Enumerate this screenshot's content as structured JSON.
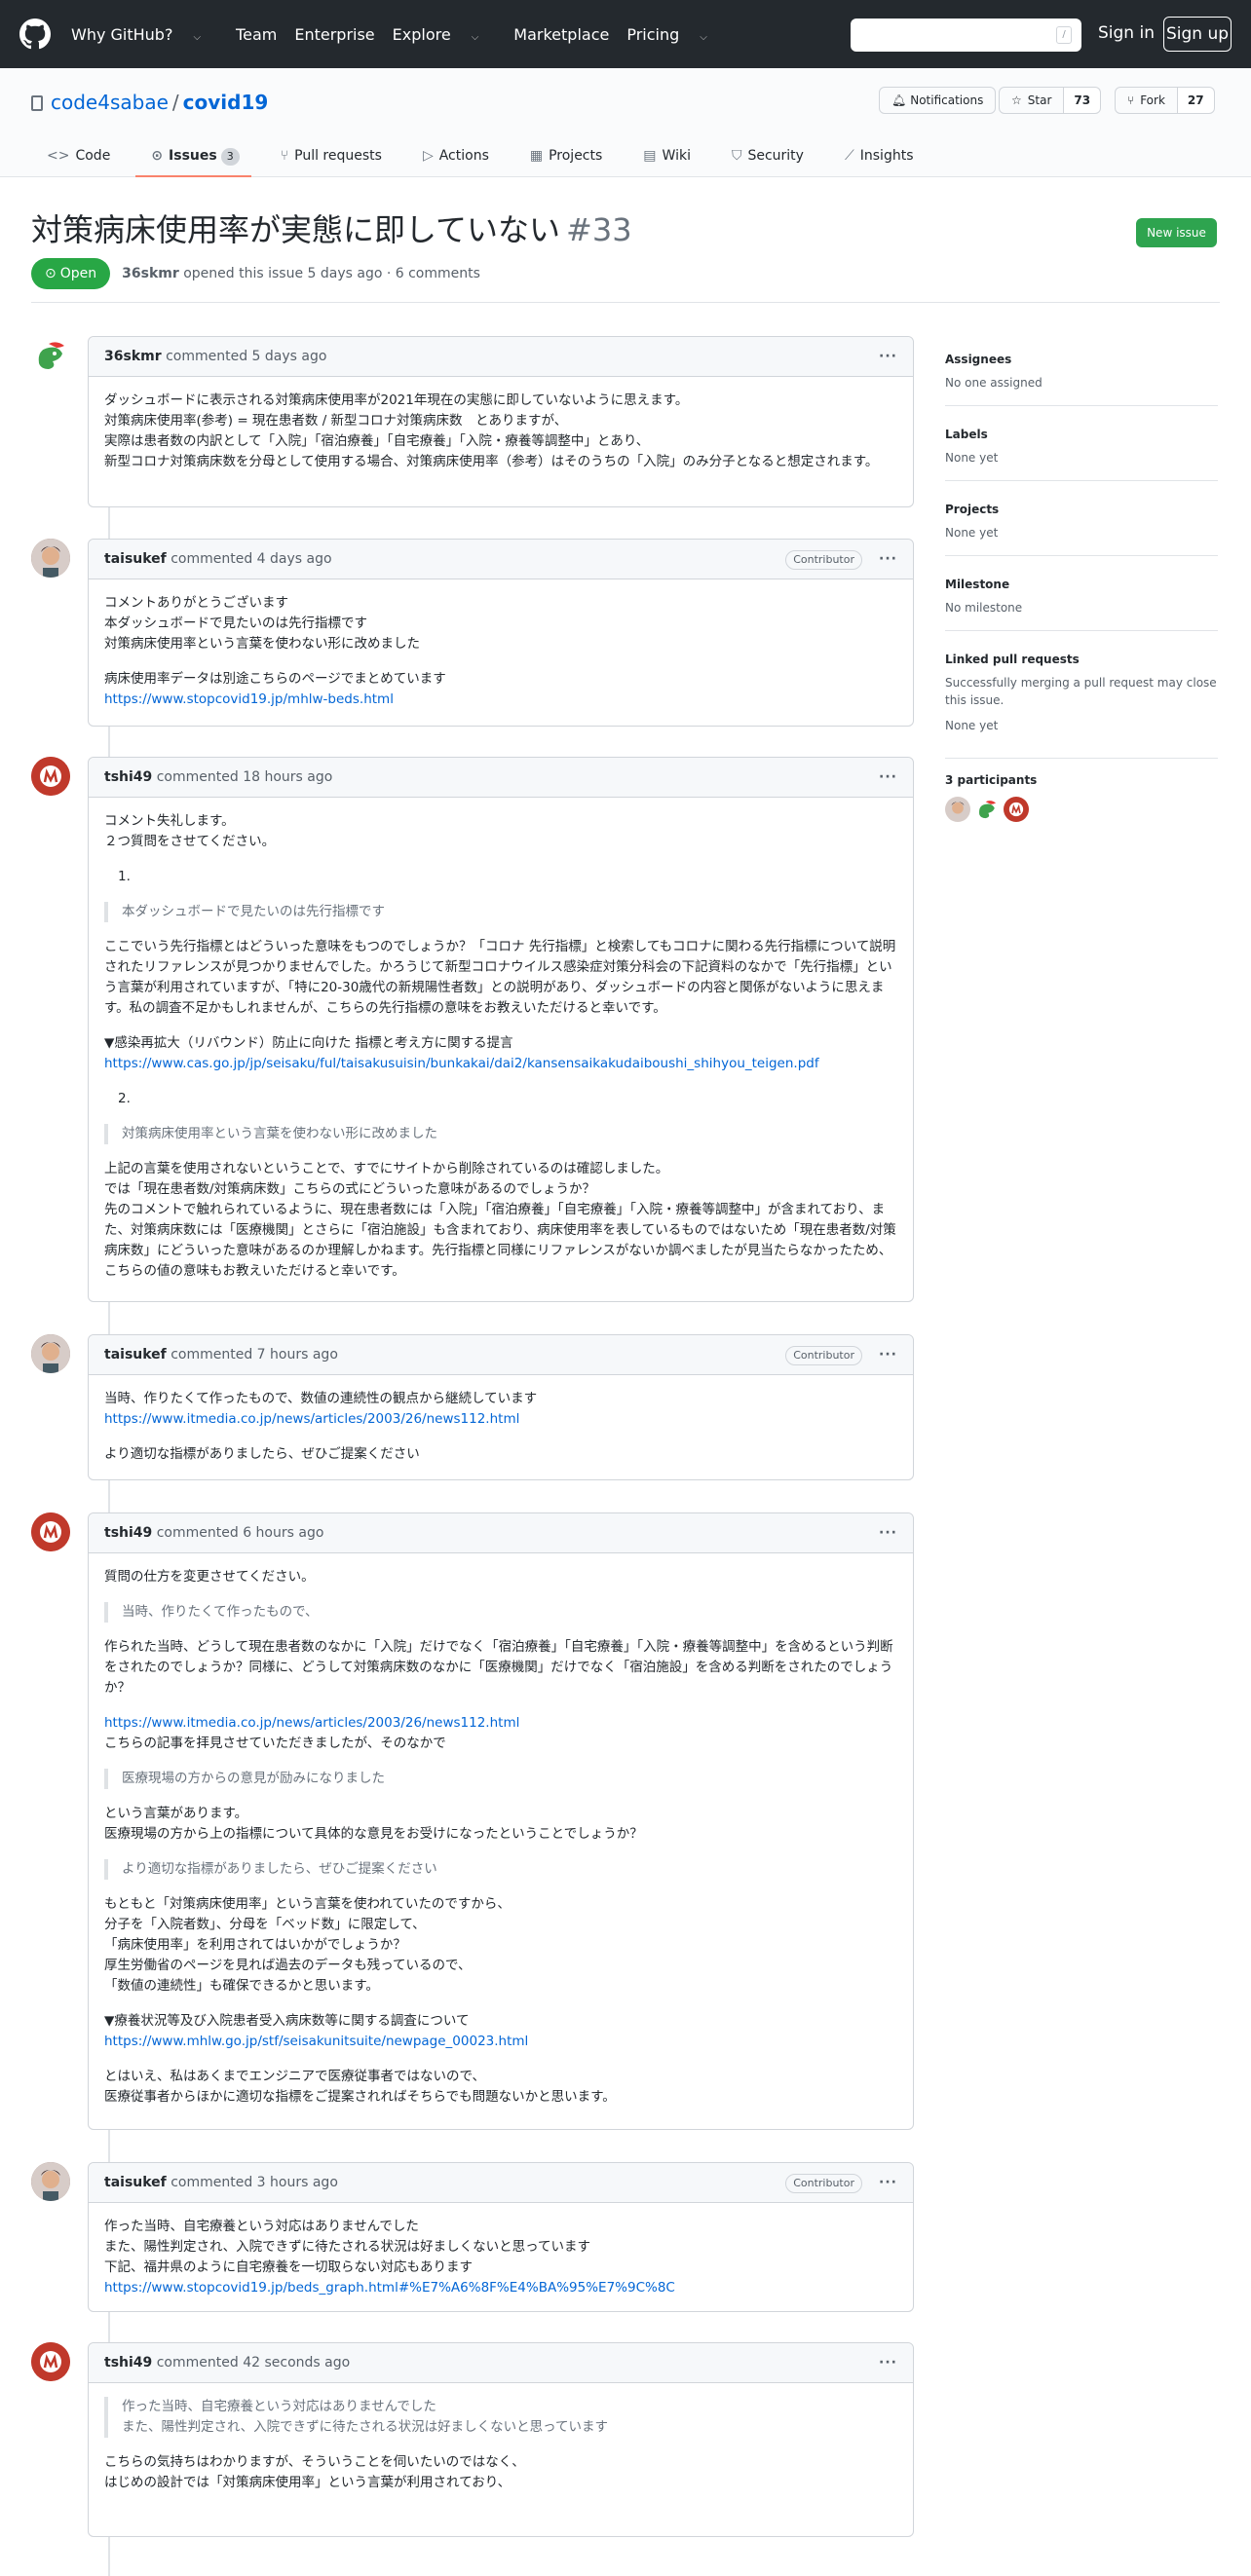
{
  "header": {
    "nav": [
      "Why GitHub?",
      "Team",
      "Enterprise",
      "Explore",
      "Marketplace",
      "Pricing"
    ],
    "search_key": "/",
    "signin": "Sign in",
    "signup": "Sign up"
  },
  "repo": {
    "owner": "code4sabae",
    "sep": "/",
    "name": "covid19",
    "notifications": "Notifications",
    "star": "Star",
    "star_count": "73",
    "fork": "Fork",
    "fork_count": "27"
  },
  "tabs": [
    {
      "label": "Code",
      "icon": "<>"
    },
    {
      "label": "Issues",
      "icon": "⊙",
      "count": "3"
    },
    {
      "label": "Pull requests",
      "icon": "⑂"
    },
    {
      "label": "Actions",
      "icon": "▷"
    },
    {
      "label": "Projects",
      "icon": "▦"
    },
    {
      "label": "Wiki",
      "icon": "▤"
    },
    {
      "label": "Security",
      "icon": "⛉"
    },
    {
      "label": "Insights",
      "icon": "⟋"
    }
  ],
  "issue": {
    "title": "対策病床使用率が実態に即していない",
    "number": "#33",
    "new_issue": "New issue",
    "state": "Open",
    "author": "36skmr",
    "meta": "opened this issue 5 days ago · 6 comments"
  },
  "comments": [
    {
      "author": "36skmr",
      "time": "commented 5 days ago",
      "role": "",
      "lines": [
        "ダッシュボードに表示される対策病床使用率が2021年現在の実態に即していないように思えます。",
        "対策病床使用率(参考) = 現在患者数 / 新型コロナ対策病床数　とありますが、",
        "実際は患者数の内訳として「入院」「宿泊療養」「自宅療養」「入院・療養等調整中」とあり、",
        "新型コロナ対策病床数を分母として使用する場合、対策病床使用率（参考）はそのうちの「入院」のみ分子となると想定されます。"
      ]
    },
    {
      "author": "taisukef",
      "time": "commented 4 days ago",
      "role": "Contributor",
      "p1": [
        "コメントありがとうございます",
        "本ダッシュボードで見たいのは先行指標です",
        "対策病床使用率という言葉を使わない形に改めました"
      ],
      "p2": "病床使用率データは別途こちらのページでまとめています",
      "link": "https://www.stopcovid19.jp/mhlw-beds.html"
    },
    {
      "author": "tshi49",
      "time": "commented 18 hours ago",
      "role": "",
      "intro": [
        "コメント失礼します。",
        "２つ質問をさせてください。"
      ],
      "n1": "1.",
      "q1": "本ダッシュボードで見たいのは先行指標です",
      "p1": "ここでいう先行指標とはどういった意味をもつのでしょうか？「コロナ 先行指標」と検索してもコロナに関わる先行指標について説明されたリファレンスが見つかりませんでした。かろうじて新型コロナウイルス感染症対策分科会の下記資料のなかで「先行指標」という言葉が利用されていますが、「特に20-30歳代の新規陽性者数」との説明があり、ダッシュボードの内容と関係がないように思えます。私の調査不足かもしれませんが、こちらの先行指標の意味をお教えいただけると幸いです。",
      "p2": "▼感染再拡大（リバウンド）防止に向けた 指標と考え方に関する提言",
      "link": "https://www.cas.go.jp/jp/seisaku/ful/taisakusuisin/bunkakai/dai2/kansensaikakudaiboushi_shihyou_teigen.pdf",
      "n2": "2.",
      "q2": "対策病床使用率という言葉を使わない形に改めました",
      "p3": "上記の言葉を使用されないということで、すでにサイトから削除されているのは確認しました。",
      "p4": "では「現在患者数/対策病床数」こちらの式にどういった意味があるのでしょうか？",
      "p5": "先のコメントで触れられているように、現在患者数には「入院」「宿泊療養」「自宅療養」「入院・療養等調整中」が含まれており、また、対策病床数には「医療機関」とさらに「宿泊施設」も含まれており、病床使用率を表しているものではないため「現在患者数/対策病床数」にどういった意味があるのか理解しかねます。先行指標と同様にリファレンスがないか調べましたが見当たらなかったため、こちらの値の意味もお教えいただけると幸いです。"
    },
    {
      "author": "taisukef",
      "time": "commented 7 hours ago",
      "role": "Contributor",
      "p1": "当時、作りたくて作ったもので、数値の連続性の観点から継続しています",
      "link": "https://www.itmedia.co.jp/news/articles/2003/26/news112.html",
      "p2": "より適切な指標がありましたら、ぜひご提案ください"
    },
    {
      "author": "tshi49",
      "time": "commented 6 hours ago",
      "role": "",
      "p1": "質問の仕方を変更させてください。",
      "q1": "当時、作りたくて作ったもので、",
      "p2": "作られた当時、どうして現在患者数のなかに「入院」だけでなく「宿泊療養」「自宅療養」「入院・療養等調整中」を含めるという判断をされたのでしょうか？同様に、どうして対策病床数のなかに「医療機関」だけでなく「宿泊施設」を含める判断をされたのでしょうか？",
      "link1": "https://www.itmedia.co.jp/news/articles/2003/26/news112.html",
      "p3": "こちらの記事を拝見させていただきましたが、そのなかで",
      "q2": "医療現場の方からの意見が励みになりました",
      "p4": [
        "という言葉があります。",
        "医療現場の方から上の指標について具体的な意見をお受けになったということでしょうか？"
      ],
      "q3": "より適切な指標がありましたら、ぜひご提案ください",
      "p5": [
        "もともと「対策病床使用率」という言葉を使われていたのですから、",
        "分子を「入院者数」、分母を「ベッド数」に限定して、",
        "「病床使用率」を利用されてはいかがでしょうか？",
        "厚生労働省のページを見れば過去のデータも残っているので、",
        "「数値の連続性」も確保できるかと思います。"
      ],
      "p6": "▼療養状況等及び入院患者受入病床数等に関する調査について",
      "link2": "https://www.mhlw.go.jp/stf/seisakunitsuite/newpage_00023.html",
      "p7": [
        "とはいえ、私はあくまでエンジニアで医療従事者ではないので、",
        "医療従事者からほかに適切な指標をご提案されればそちらでも問題ないかと思います。"
      ]
    },
    {
      "author": "taisukef",
      "time": "commented 3 hours ago",
      "role": "Contributor",
      "lines": [
        "作った当時、自宅療養という対応はありませんでした",
        "また、陽性判定され、入院できずに待たされる状況は好ましくないと思っています",
        "下記、福井県のように自宅療養を一切取らない対応もあります"
      ],
      "link": "https://www.stopcovid19.jp/beds_graph.html#%E7%A6%8F%E4%BA%95%E7%9C%8C"
    },
    {
      "author": "tshi49",
      "time": "commented 42 seconds ago",
      "role": "",
      "quote": [
        "作った当時、自宅療養という対応はありませんでした",
        "また、陽性判定され、入院できずに待たされる状況は好ましくないと思っています"
      ],
      "lines": [
        "こちらの気持ちはわかりますが、そういうことを伺いたいのではなく、",
        "はじめの設計では「対策病床使用率」という言葉が利用されており、"
      ]
    }
  ],
  "sidebar": {
    "assignees_label": "Assignees",
    "assignees_value": "No one assigned",
    "labels_label": "Labels",
    "labels_value": "None yet",
    "projects_label": "Projects",
    "projects_value": "None yet",
    "milestone_label": "Milestone",
    "milestone_value": "No milestone",
    "linked_label": "Linked pull requests",
    "linked_desc": "Successfully merging a pull request may close this issue.",
    "linked_value": "None yet",
    "participants_label": "3 participants"
  }
}
